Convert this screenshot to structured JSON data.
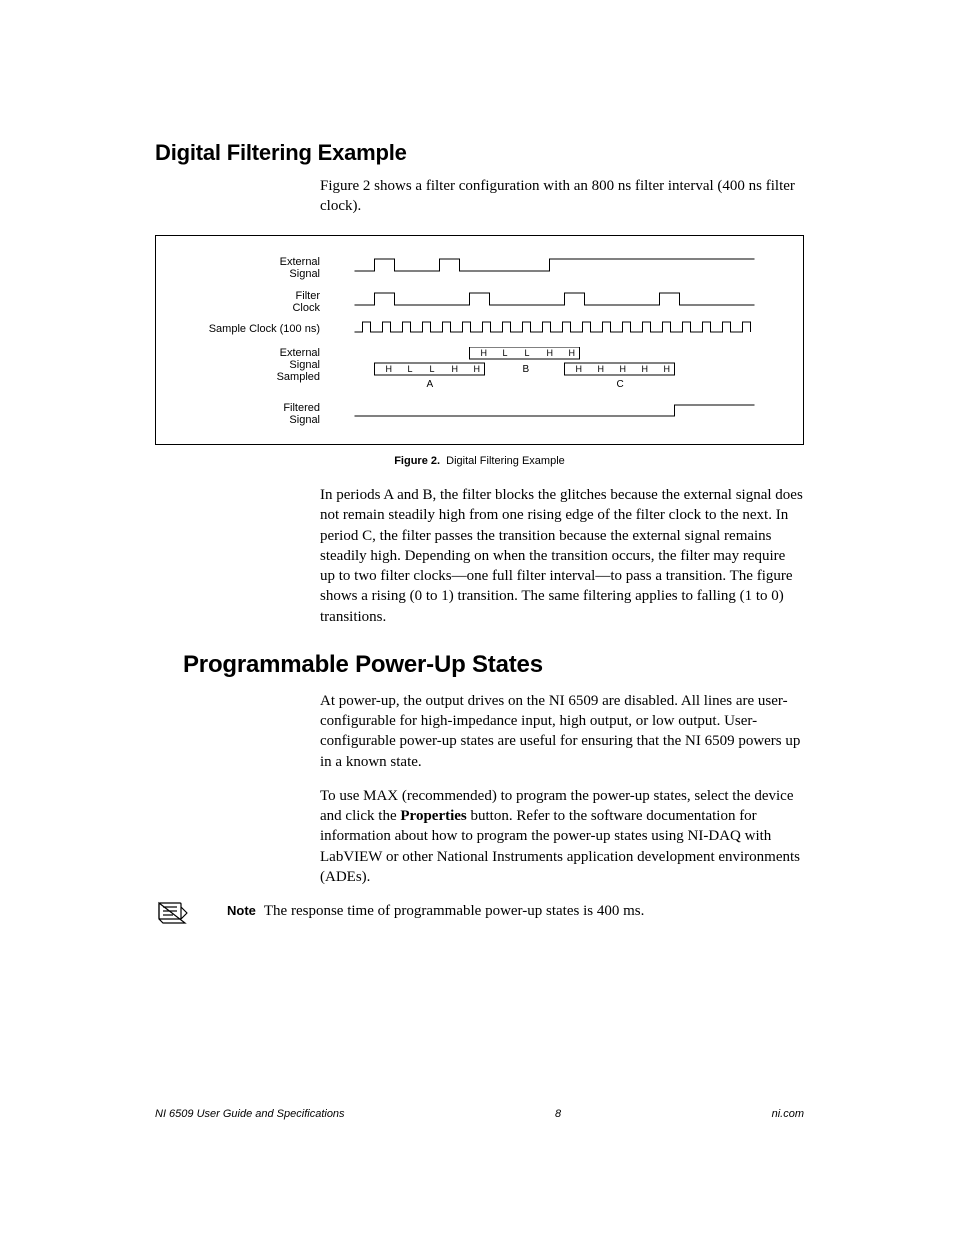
{
  "section1": {
    "title": "Digital Filtering Example",
    "intro": "Figure 2 shows a filter configuration with an 800 ns filter interval (400 ns filter clock)."
  },
  "figure": {
    "labels": {
      "external_signal": "External\nSignal",
      "filter_clock": "Filter\nClock",
      "sample_clock": "Sample Clock (100 ns)",
      "external_sampled": "External\nSignal\nSampled",
      "filtered_signal": "Filtered\nSignal"
    },
    "sampled_row1": [
      "H",
      "L",
      "L",
      "H",
      "H"
    ],
    "sampled_row2_left": [
      "H",
      "L",
      "L",
      "H",
      "H"
    ],
    "sampled_row2_mid": "B",
    "sampled_row2_right": [
      "H",
      "H",
      "H",
      "H",
      "H"
    ],
    "period_a": "A",
    "period_c": "C",
    "caption_bold": "Figure 2.",
    "caption_rest": "Digital Filtering Example"
  },
  "para_after_fig": "In periods A and B, the filter blocks the glitches because the external signal does not remain steadily high from one rising edge of the filter clock to the next. In period C, the filter passes the transition because the external signal remains steadily high. Depending on when the transition occurs, the filter may require up to two filter clocks—one full filter interval—to pass a transition. The figure shows a rising (0 to 1) transition. The same filtering applies to falling (1 to 0) transitions.",
  "section2": {
    "title": "Programmable Power-Up States",
    "p1": "At power-up, the output drives on the NI 6509 are disabled. All lines are user-configurable for high-impedance input, high output, or low output. User-configurable power-up states are useful for ensuring that the NI 6509 powers up in a known state.",
    "p2_before": "To use MAX (recommended) to program the power-up states, select the device and click the ",
    "p2_bold": "Properties",
    "p2_after": " button. Refer to the software documentation for information about how to program the power-up states using NI-DAQ with LabVIEW or other National Instruments application development environments (ADEs)."
  },
  "note": {
    "label": "Note",
    "text": "The response time of programmable power-up states is 400 ms."
  },
  "footer": {
    "left": "NI 6509 User Guide and Specifications",
    "center": "8",
    "right": "ni.com"
  }
}
